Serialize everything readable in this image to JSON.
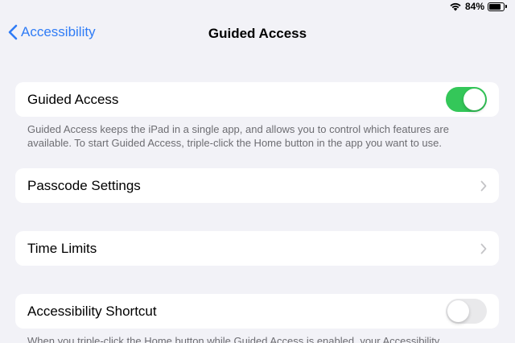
{
  "status_bar": {
    "battery_percent": "84%",
    "battery_level": 0.84
  },
  "nav": {
    "back_label": "Accessibility",
    "title": "Guided Access"
  },
  "guided_access": {
    "label": "Guided Access",
    "enabled": true,
    "footer": "Guided Access keeps the iPad in a single app, and allows you to control which features are available. To start Guided Access, triple-click the Home button in the app you want to use."
  },
  "passcode_settings": {
    "label": "Passcode Settings"
  },
  "time_limits": {
    "label": "Time Limits"
  },
  "accessibility_shortcut": {
    "label": "Accessibility Shortcut",
    "enabled": false,
    "footer": "When you triple-click the Home button while Guided Access is enabled, your Accessibility"
  },
  "colors": {
    "accent": "#2f7cf6",
    "toggle_on": "#34c759",
    "background": "#f2f2f7"
  }
}
